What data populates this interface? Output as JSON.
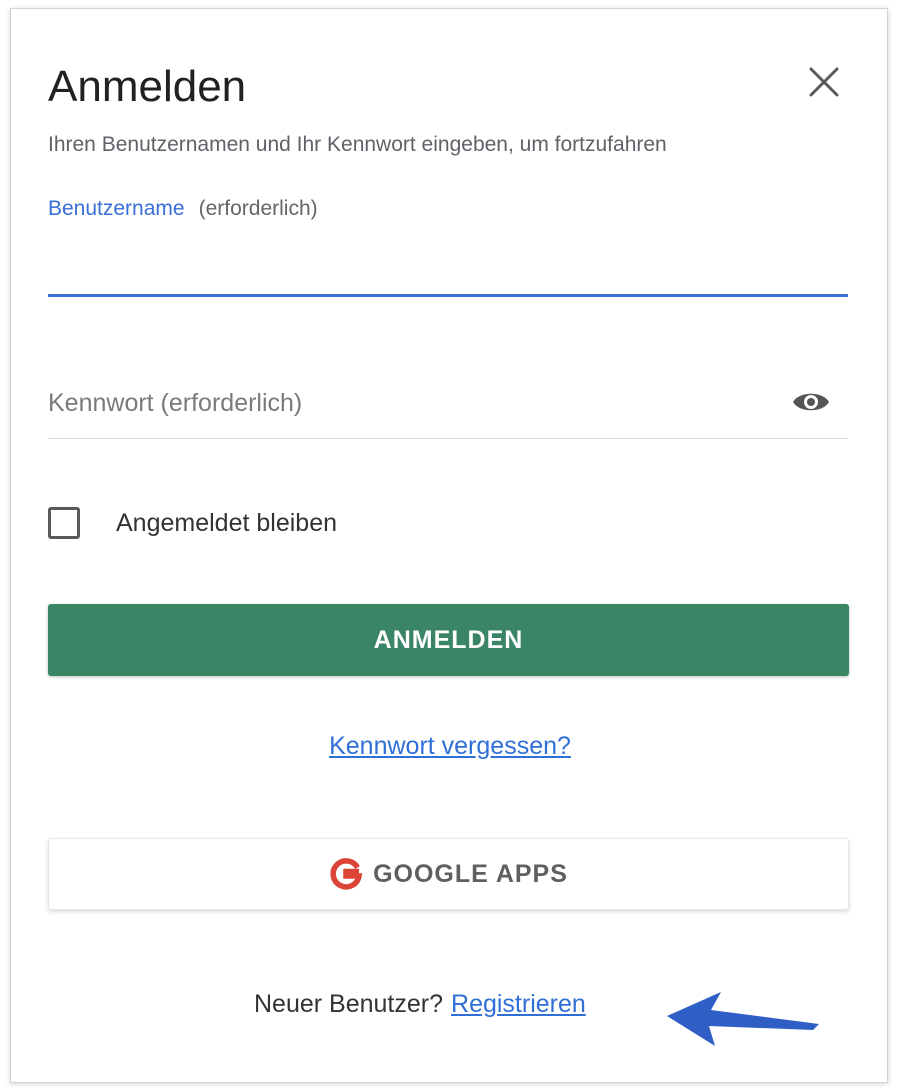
{
  "dialog": {
    "title": "Anmelden",
    "subtitle": "Ihren Benutzernamen und Ihr Kennwort eingeben, um fortzufahren",
    "close_icon": "close-icon"
  },
  "username": {
    "label": "Benutzername",
    "required_text": "(erforderlich)",
    "value": ""
  },
  "password": {
    "placeholder": "Kennwort (erforderlich)",
    "value": "",
    "toggle_icon": "eye-icon"
  },
  "remember_me": {
    "label": "Angemeldet bleiben",
    "checked": false
  },
  "login_button": {
    "label": "ANMELDEN"
  },
  "forgot_password": {
    "label": "Kennwort vergessen?"
  },
  "google_button": {
    "label": "GOOGLE APPS",
    "icon": "google-g-icon"
  },
  "register": {
    "prompt": "Neuer Benutzer?",
    "link_label": "Registrieren"
  },
  "colors": {
    "accent_blue": "#3a6fd8",
    "login_green": "#3b8567",
    "google_red": "#db4437",
    "annotation_arrow": "#2f5fc4"
  }
}
